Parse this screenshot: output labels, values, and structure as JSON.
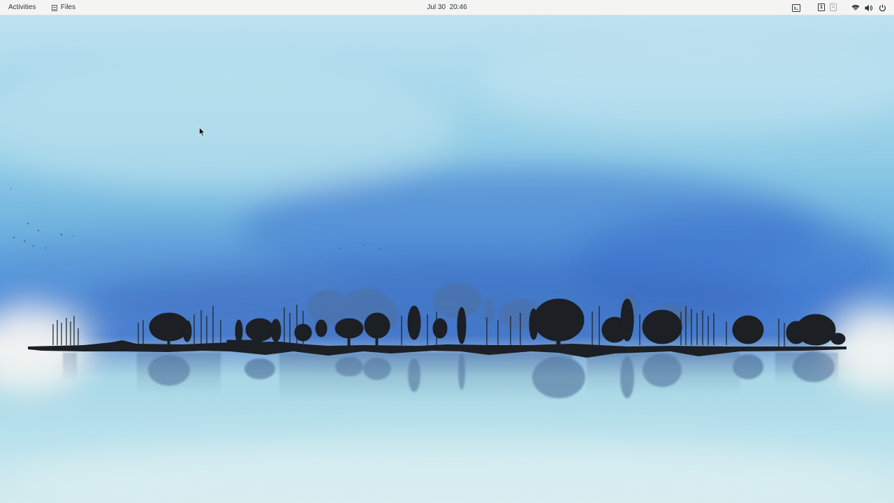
{
  "topbar": {
    "activities_label": "Activities",
    "app_menu": {
      "icon": "files-app-icon",
      "label": "Files"
    },
    "clock": "Jul 30  20:46",
    "tray": {
      "terminal_icon": "terminal-icon",
      "workspaces": [
        "1",
        "A"
      ],
      "network_icon": "wifi-icon",
      "volume_icon": "volume-icon",
      "power_icon": "power-icon"
    }
  },
  "wallpaper": {
    "description_icon": "misty-lake-trees-wallpaper"
  },
  "colors": {
    "topbar_bg": "#f4f4f3",
    "sky_top": "#c3e3f0",
    "sky_deep": "#4d8ed8",
    "water": "#b7e1ec",
    "silhouette": "#1c1f24"
  }
}
